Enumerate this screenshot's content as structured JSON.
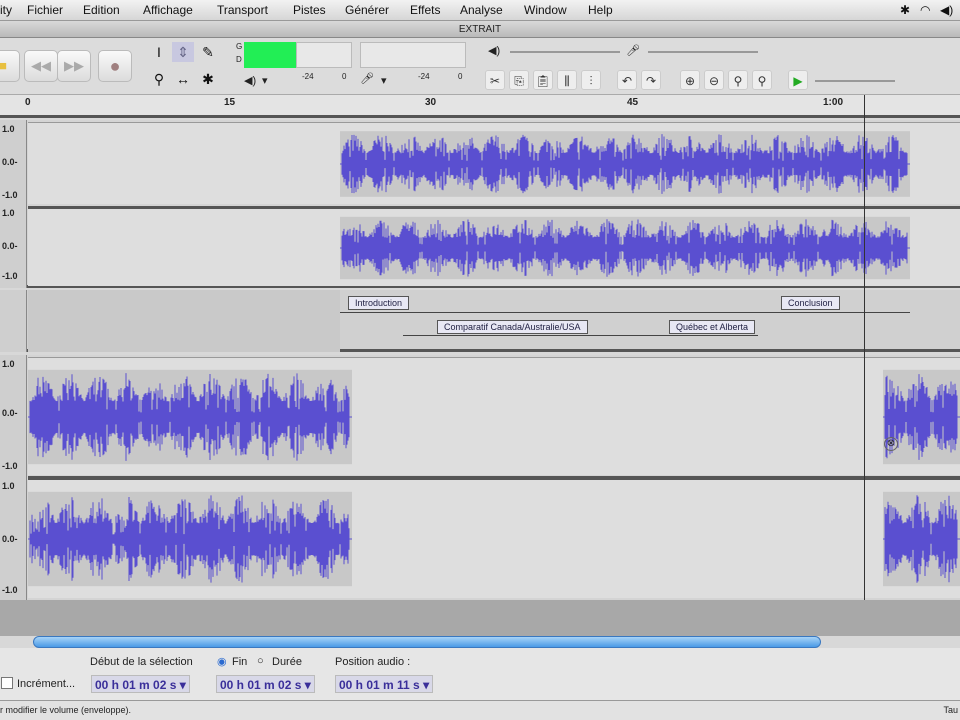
{
  "menubar": {
    "items": [
      "ity",
      "Fichier",
      "Edition",
      "Affichage",
      "Transport",
      "Pistes",
      "Générer",
      "Effets",
      "Analyse",
      "Window",
      "Help"
    ]
  },
  "window": {
    "title": "EXTRAIT"
  },
  "meters": {
    "left_label": "G",
    "right_label": "D",
    "ticks": [
      "-24",
      "0",
      "-24",
      "0"
    ]
  },
  "ruler": {
    "ticks": [
      "0",
      "15",
      "30",
      "45",
      "1:00"
    ]
  },
  "scale": {
    "top": "1.0",
    "mid": "0.0-",
    "bottom": "-1.0"
  },
  "labels": [
    {
      "text": "Introduction"
    },
    {
      "text": "Comparatif Canada/Australie/USA"
    },
    {
      "text": "Québec et Alberta"
    },
    {
      "text": "Conclusion"
    }
  ],
  "selection": {
    "start_label": "Début de la sélection",
    "end_option": "Fin",
    "duration_option": "Durée",
    "audio_position_label": "Position audio :",
    "increment_label": "Incrément...",
    "start": "00 h 01 m 02 s",
    "end": "00 h 01 m 02 s",
    "position": "00 h 01 m 11 s"
  },
  "status": {
    "left": "r modifier le volume (enveloppe).",
    "right": "Tau"
  },
  "colors": {
    "wave": "#5a4fd0",
    "meter": "#22ee55"
  }
}
